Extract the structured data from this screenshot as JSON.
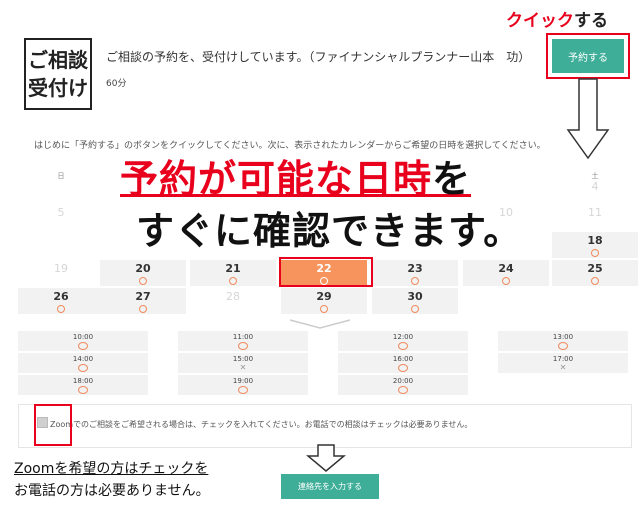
{
  "header": {
    "icon_line1": "ご相談",
    "icon_line2": "受付け",
    "title": "ご相談の予約を、受付けしています。（ファイナンシャルプランナー山本　功）",
    "duration": "60分",
    "reserve_label": "予約する"
  },
  "annotations": {
    "click_red": "クイック",
    "click_black": "する",
    "headline1_red": "予約が可能な日時",
    "headline1_black": "を",
    "headline2": "すぐに確認できます。",
    "note1": "Zoomを希望の方はチェックを",
    "note2": "お電話の方は必要ありません。"
  },
  "intro": "はじめに「予約する」のボタンをクイックしてください。次に、表示されたカレンダーからご希望の日時を選択してください。",
  "calendar": {
    "weekday_sun": "日",
    "weekday_sat": "土",
    "row1_sat": "4",
    "row2": [
      "5",
      "",
      "",
      "",
      "",
      "10",
      "11"
    ],
    "row3": [
      "",
      "",
      "",
      "",
      "",
      "",
      "18"
    ],
    "row4": [
      "19",
      "20",
      "21",
      "22",
      "23",
      "24",
      "25"
    ],
    "row5": [
      "26",
      "27",
      "28",
      "29",
      "30"
    ]
  },
  "time_slots": [
    "10:00",
    "11:00",
    "12:00",
    "13:00",
    "14:00",
    "15:00",
    "16:00",
    "17:00",
    "18:00",
    "19:00",
    "20:00"
  ],
  "zoom": {
    "text": "Zoomでのご相談をご希望される場合は、チェックを入れてください。お電話での相談はチェックは必要ありません。"
  },
  "contact_label": "連絡先を入力する",
  "colors": {
    "accent": "#3fae99",
    "annotation_red": "#e8001c",
    "selected_day": "#f7935c",
    "available_mark": "#f08a5d"
  }
}
